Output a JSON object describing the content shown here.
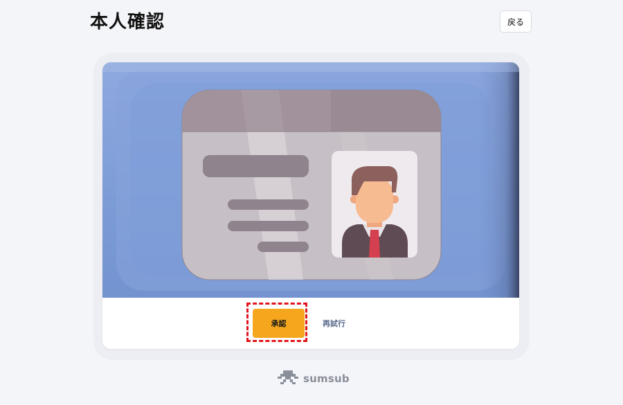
{
  "header": {
    "title": "本人確認",
    "back_label": "戻る"
  },
  "document_preview": {
    "image_kind": "id-card-illustration",
    "card_icon": "person-portrait-icon"
  },
  "actions": {
    "approve_label": "承認",
    "retry_label": "再試行",
    "approve_color": "#f5a61d",
    "highlight_color": "#e0141b"
  },
  "footer": {
    "brand_logo_icon": "sumsub-logo-icon",
    "brand_name": "sumsub"
  }
}
